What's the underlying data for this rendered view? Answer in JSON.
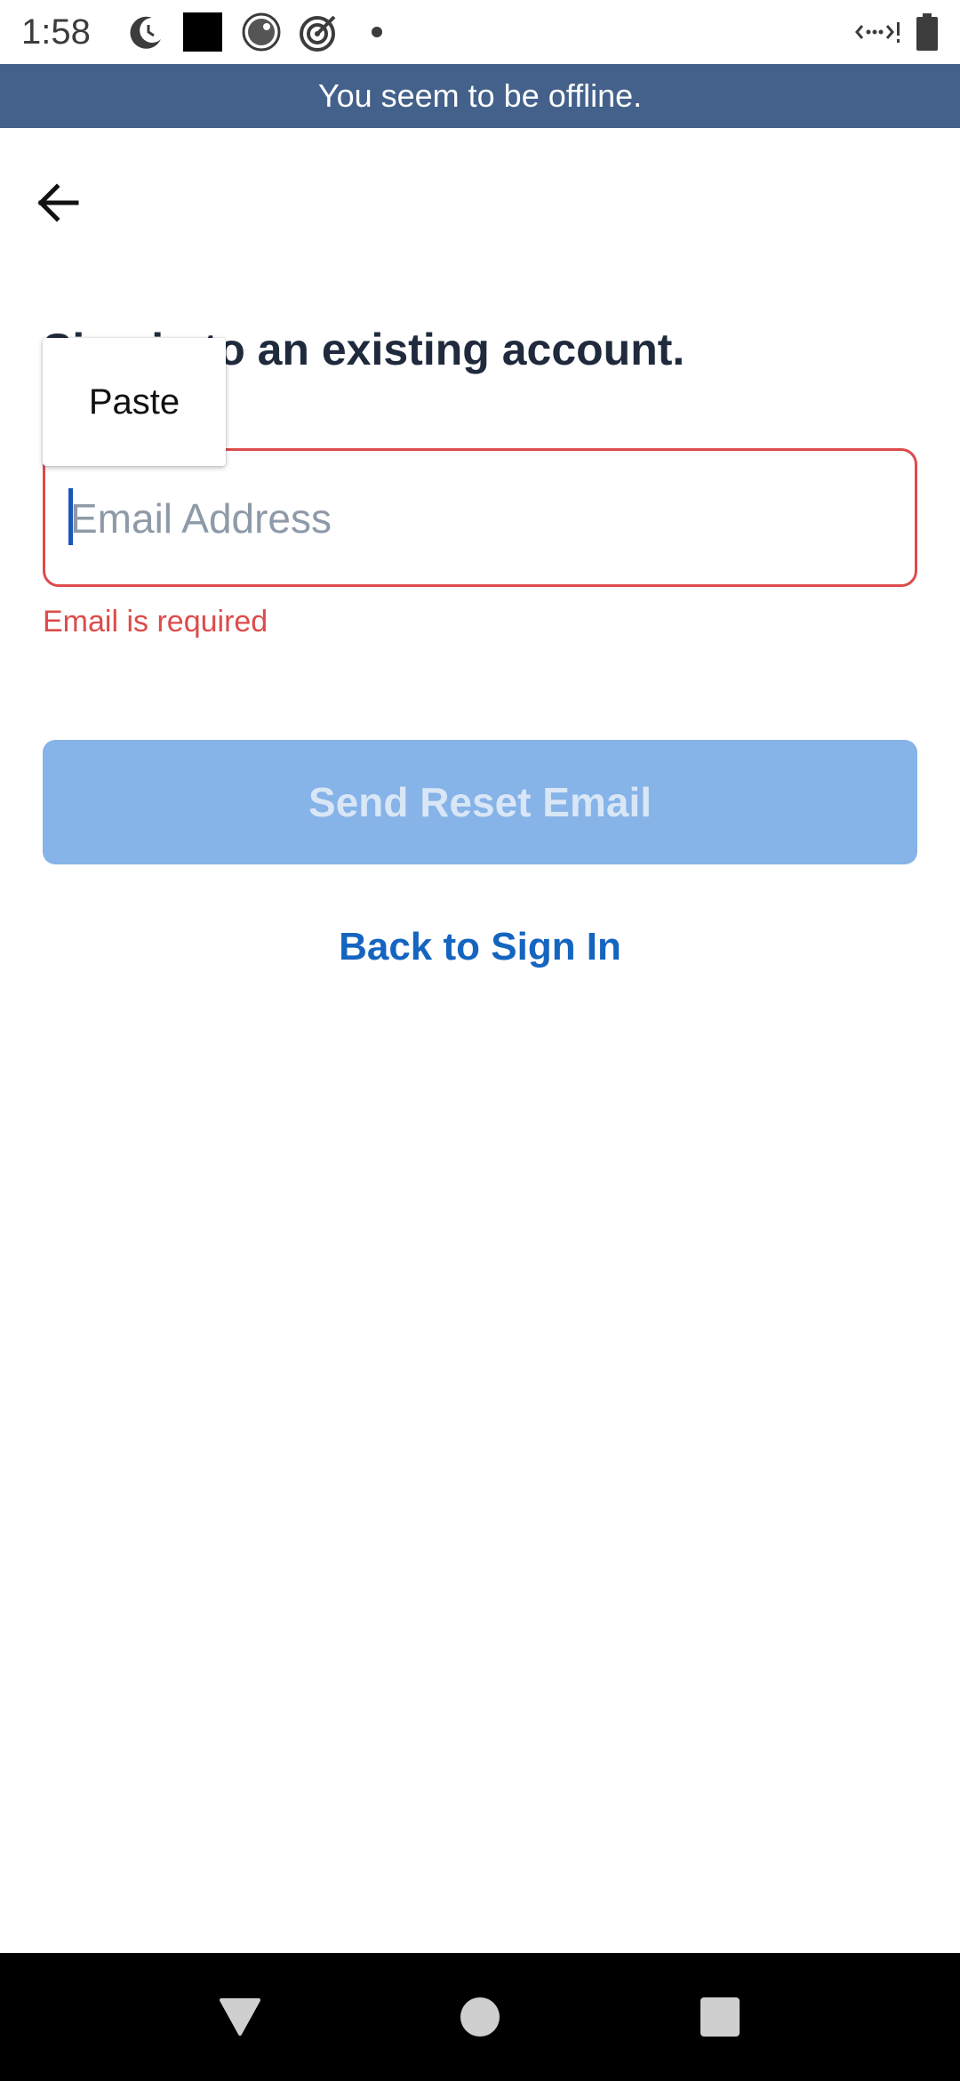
{
  "status_bar": {
    "time": "1:58",
    "icons": [
      "moon-clock-icon",
      "black-square-icon",
      "record-icon",
      "target-icon",
      "dot-icon"
    ],
    "right_icons": [
      "wifi-off-icon",
      "battery-icon"
    ]
  },
  "banner": {
    "text": "You seem to be offline."
  },
  "page": {
    "heading": "Sign in to an existing account.",
    "email_placeholder": "Email Address",
    "email_value": "",
    "error_text": "Email is required",
    "send_button_label": "Send Reset Email",
    "back_link_label": "Back to Sign In"
  },
  "context_menu": {
    "paste_label": "Paste"
  },
  "colors": {
    "banner": "#43618a",
    "error": "#dd4b4b",
    "button_disabled": "#86b3e8",
    "link": "#1565c0"
  }
}
